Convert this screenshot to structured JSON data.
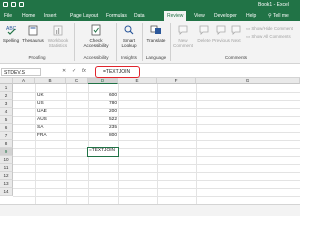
{
  "window": {
    "title": "Book1 - Excel"
  },
  "tabs": [
    {
      "label": "File"
    },
    {
      "label": "Home"
    },
    {
      "label": "Insert"
    },
    {
      "label": "Page Layout"
    },
    {
      "label": "Formulas"
    },
    {
      "label": "Data"
    },
    {
      "label": "Review"
    },
    {
      "label": "View"
    },
    {
      "label": "Developer"
    },
    {
      "label": "Help"
    }
  ],
  "tell_me": "Tell me",
  "ribbon": {
    "spelling": "Spelling",
    "thesaurus": "Thesaurus",
    "workbook_stats": "Workbook Statistics",
    "check_accessibility": "Check Accessibility",
    "smart_lookup": "Smart Lookup",
    "translate": "Translate",
    "new_comment": "New Comment",
    "delete": "Delete",
    "previous": "Previous",
    "next": "Next",
    "show_hide_comment": "Show/Hide Comment",
    "show_all_comments": "Show All Comments",
    "groups": {
      "proofing": "Proofing",
      "accessibility": "Accessibility",
      "insights": "Insights",
      "language": "Language",
      "comments": "Comments"
    }
  },
  "formula_bar": {
    "name_box": "STDEV.S",
    "cancel": "✕",
    "enter": "✓",
    "fx": "fx",
    "formula": "=TEXTJOIN"
  },
  "columns": [
    "A",
    "B",
    "C",
    "D",
    "E",
    "F",
    "G"
  ],
  "rows": [
    "1",
    "2",
    "3",
    "4",
    "5",
    "6",
    "7",
    "8",
    "9",
    "10",
    "11",
    "12",
    "13",
    "14"
  ],
  "cells": {
    "B2": "UK",
    "D2": "600",
    "B3": "US",
    "D3": "780",
    "B4": "UAE",
    "D4": "200",
    "B5": "AUS",
    "D5": "522",
    "B6": "SA",
    "D6": "235",
    "B7": "FRA",
    "D7": "800",
    "D9": "=TEXTJOIN"
  },
  "colors": {
    "excel_green": "#217346",
    "highlight_red": "#e0242c"
  }
}
